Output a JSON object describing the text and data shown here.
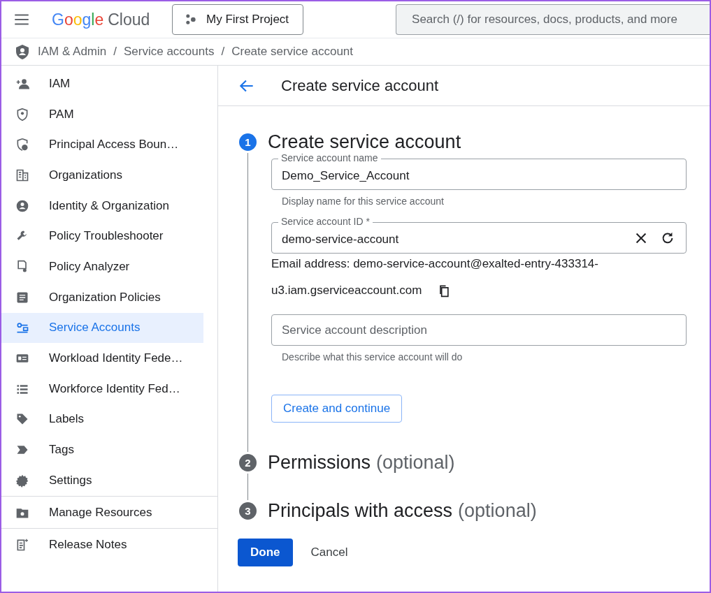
{
  "topbar": {
    "logo": {
      "brand": "Google",
      "product": "Cloud"
    },
    "project": "My First Project",
    "search": {
      "placeholder": "Search (/) for resources, docs, products, and more"
    }
  },
  "breadcrumb": [
    {
      "label": "IAM & Admin"
    },
    {
      "separator": "/",
      "label": "Service accounts"
    },
    {
      "separator": "/",
      "label": "Create service account"
    }
  ],
  "sidebar": {
    "items": [
      {
        "label": "IAM",
        "selected": false
      },
      {
        "label": "PAM",
        "selected": false
      },
      {
        "label": "Principal Access Boun…",
        "selected": false
      },
      {
        "label": "Organizations",
        "selected": false
      },
      {
        "label": "Identity & Organization",
        "selected": false
      },
      {
        "label": "Policy Troubleshooter",
        "selected": false
      },
      {
        "label": "Policy Analyzer",
        "selected": false
      },
      {
        "label": "Organization Policies",
        "selected": false
      },
      {
        "label": "Service Accounts",
        "selected": true
      },
      {
        "label": "Workload Identity Fede…",
        "selected": false
      },
      {
        "label": "Workforce Identity Fed…",
        "selected": false
      },
      {
        "label": "Labels",
        "selected": false
      },
      {
        "label": "Tags",
        "selected": false
      },
      {
        "label": "Settings",
        "selected": false
      }
    ],
    "footer": [
      {
        "label": "Manage Resources"
      },
      {
        "label": "Release Notes"
      }
    ]
  },
  "page": {
    "title": "Create service account",
    "steps": [
      {
        "number": "1",
        "title": "Create service account",
        "active": true,
        "fields": [
          {
            "label": "Service account name",
            "value": "Demo_Service_Account",
            "hint": "Display name for this service account"
          },
          {
            "label": "Service account ID *",
            "value": "demo-service-account",
            "actions": true
          }
        ],
        "email": {
          "line1": "Email address: demo-service-account@exalted-entry-433314-",
          "line2": "u3.iam.gserviceaccount.com"
        },
        "description": {
          "placeholder": "Service account description",
          "hint": "Describe what this service account will do"
        },
        "button": "Create and continue"
      },
      {
        "number": "2",
        "title": "Permissions",
        "suffix": "(optional)",
        "active": false
      },
      {
        "number": "3",
        "title": "Principals with access",
        "suffix": "(optional)",
        "active": false
      }
    ],
    "buttons": [
      {
        "label": "Done",
        "kind": "primary"
      },
      {
        "label": "Cancel",
        "kind": "text"
      }
    ]
  }
}
